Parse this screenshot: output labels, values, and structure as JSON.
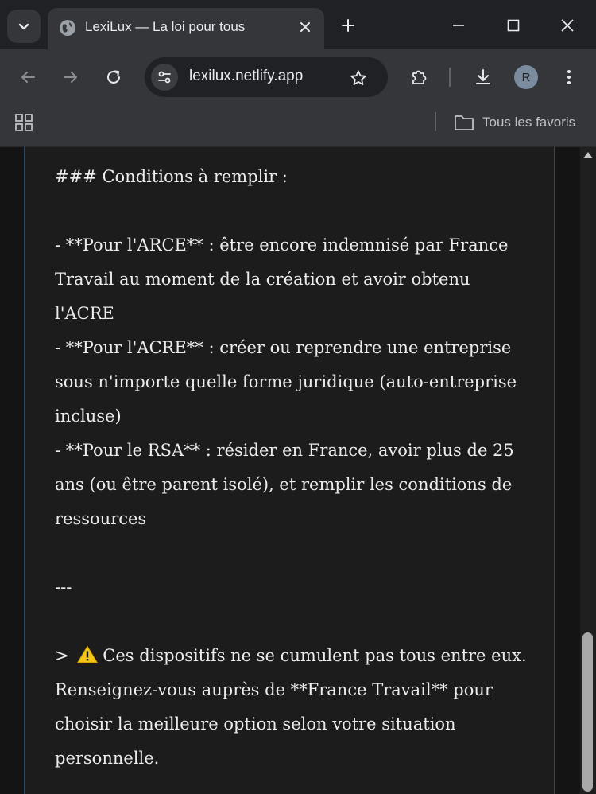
{
  "browser": {
    "tab_title": "LexiLux — La loi pour tous",
    "url": "lexilux.netlify.app",
    "profile_initial": "R",
    "bookmarks_folder": "Tous les favoris"
  },
  "content": {
    "heading": "### Conditions à remplir :",
    "items": [
      "- **Pour l'ARCE** : être encore indemnisé par France Travail au moment de la création et avoir obtenu l'ACRE",
      "- **Pour l'ACRE** : créer ou reprendre une entreprise sous n'importe quelle forme juridique (auto-entreprise incluse)",
      "- **Pour le RSA** : résider en France, avoir plus de 25 ans (ou être parent isolé), et remplir les conditions de ressources"
    ],
    "divider": "---",
    "note_prefix": ">",
    "note_text": "Ces dispositifs ne se cumulent pas tous entre eux. Renseignez-vous auprès de **France Travail** pour choisir la meilleure option selon votre situation personnelle."
  },
  "scroll": {
    "position_fraction": 0.9
  }
}
